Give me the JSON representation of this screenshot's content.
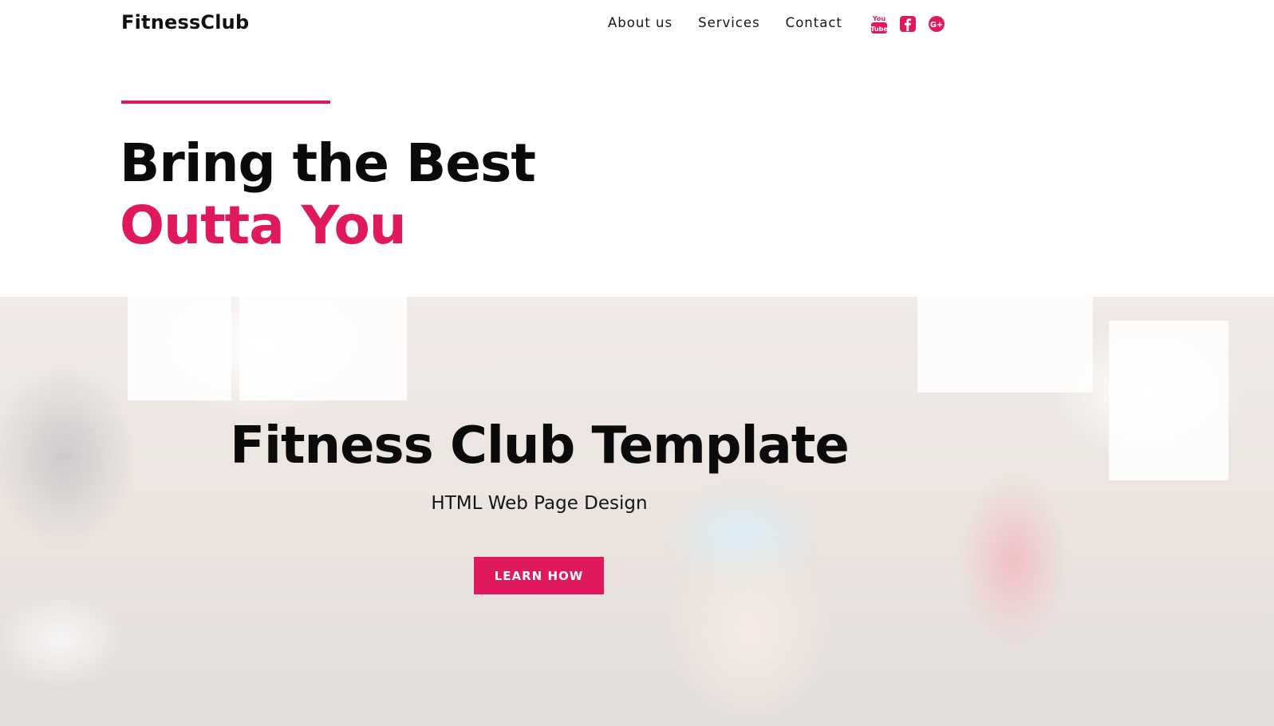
{
  "header": {
    "brand": "FitnessClub",
    "nav": [
      {
        "label": "About us"
      },
      {
        "label": "Services"
      },
      {
        "label": "Contact"
      }
    ],
    "social": [
      {
        "name": "youtube-icon",
        "label": "You Tube"
      },
      {
        "name": "facebook-icon"
      },
      {
        "name": "google-plus-icon",
        "label": "G+"
      }
    ]
  },
  "intro": {
    "line1": "Bring the Best",
    "line2": "Outta You"
  },
  "hero": {
    "title": "Fitness Club Template",
    "subtitle": "HTML Web Page Design",
    "button_label": "LEARN HOW"
  },
  "colors": {
    "accent": "#e0195e",
    "text": "#0b0b0b",
    "background": "#ffffff"
  }
}
